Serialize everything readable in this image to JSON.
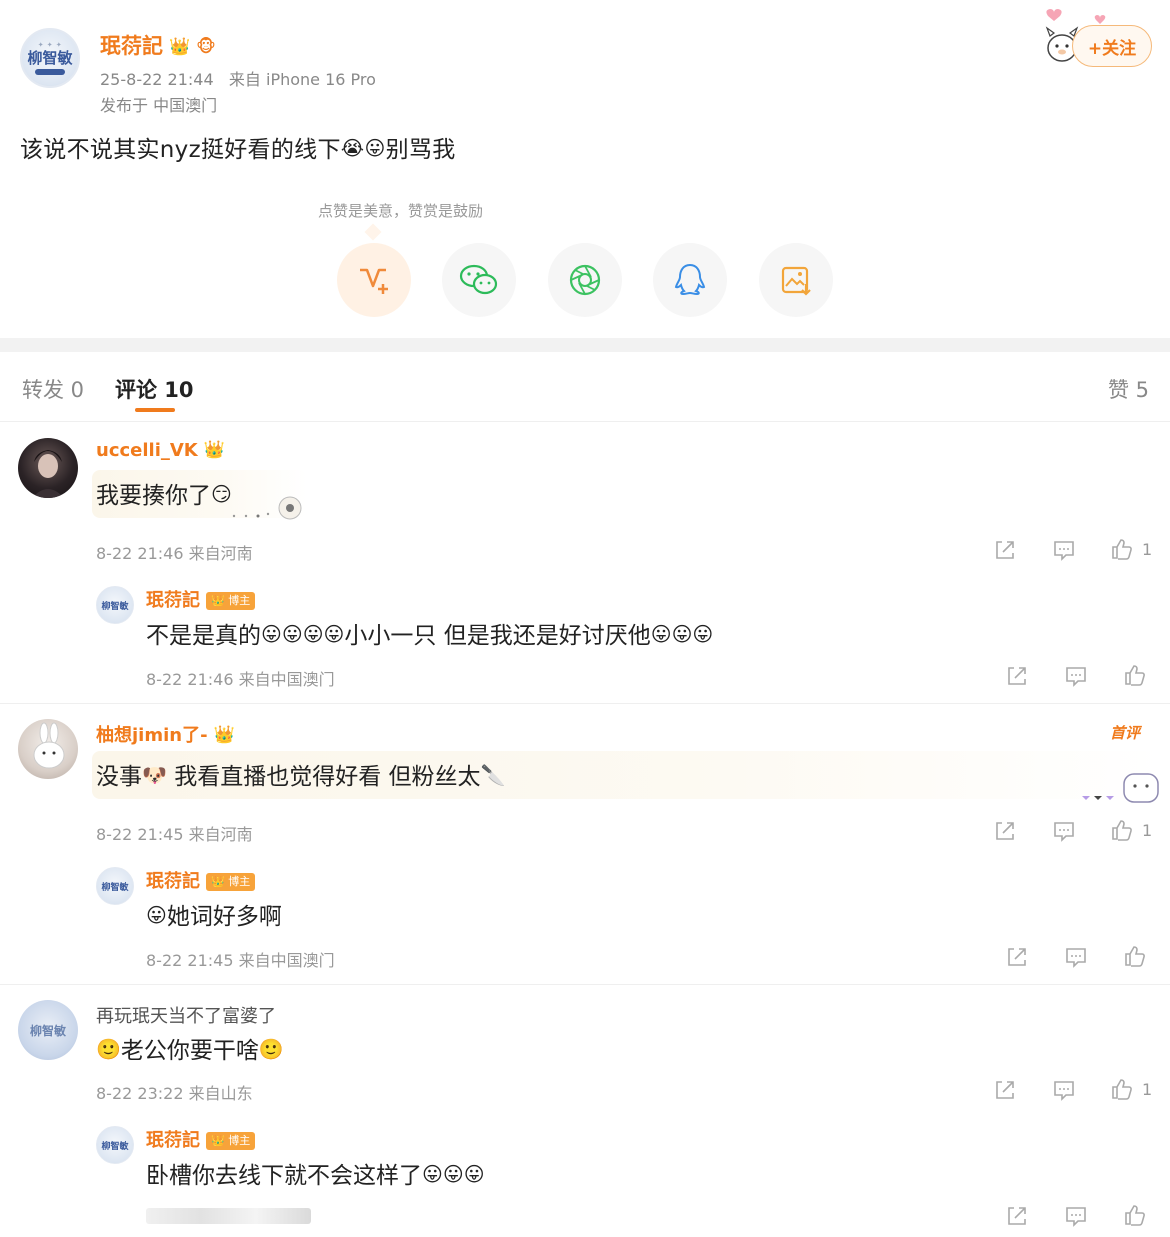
{
  "post": {
    "author": "珉葕記",
    "avatar_text": "柳智敏",
    "timestamp": "25-8-22 21:44",
    "source_prefix": "来自",
    "device": "iPhone 16 Pro",
    "location": "发布于 中国澳门",
    "text_part1": "该说不说其实nyz挺好看的线下",
    "text_part2": "别骂我",
    "follow_label": "+关注"
  },
  "reward": {
    "tip": "点赞是美意，赞赏是鼓励",
    "buttons": [
      "reward-v-plus-icon",
      "wechat-icon",
      "moments-icon",
      "qq-icon",
      "save-image-icon"
    ]
  },
  "tabs": {
    "repost": "转发 0",
    "comments": "评论 10",
    "likes": "赞 5"
  },
  "comments": [
    {
      "name": "uccelli_VK",
      "text": "我要揍你了",
      "meta": "8-22 21:46 来自河南",
      "likes": "1",
      "reply": {
        "name": "珉葕記",
        "badge": "博主",
        "text_part1": "不是是真的",
        "text_part2": "小小一只 但是我还是好讨厌他",
        "meta": "8-22 21:46 来自中国澳门"
      }
    },
    {
      "name": "柚想jimin了-",
      "top_tag": "首评",
      "text_part1": "没事",
      "text_part2": " 我看直播也觉得好看 但粉丝太",
      "meta": "8-22 21:45 来自河南",
      "likes": "1",
      "reply": {
        "name": "珉葕記",
        "badge": "博主",
        "text": "她词好多啊",
        "meta": "8-22 21:45 来自中国澳门"
      }
    },
    {
      "name": "再玩珉天当不了富婆了",
      "text": "老公你要干啥",
      "meta": "8-22 23:22 来自山东",
      "likes": "1",
      "reply": {
        "name": "珉葕記",
        "badge": "博主",
        "text": "卧槽你去线下就不会这样了"
      }
    }
  ],
  "colors": {
    "accent": "#f07b1d",
    "reward_bg": "#fff1e4",
    "divider": "#f2f2f2"
  }
}
